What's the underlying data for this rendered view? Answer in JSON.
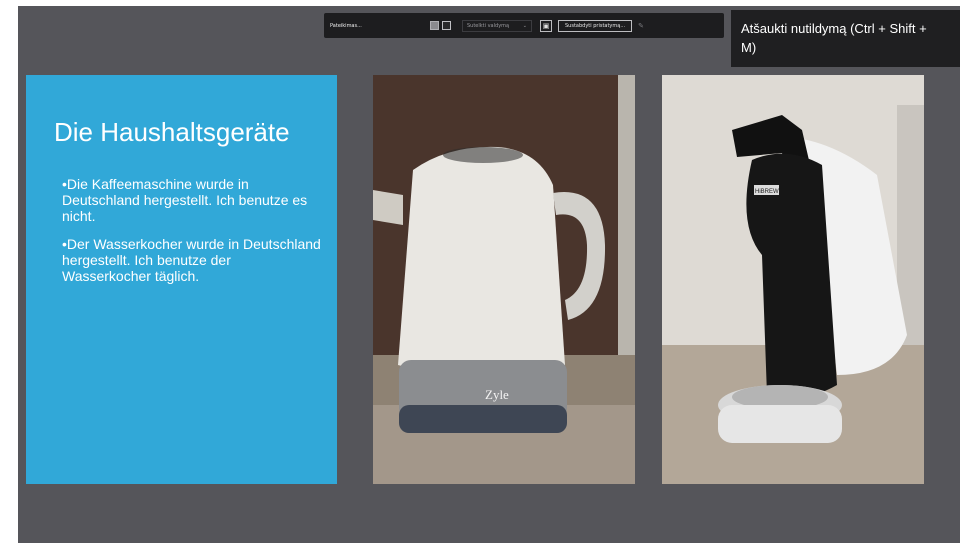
{
  "toolbar": {
    "presenter_name": "Pateikimas...",
    "select_value": "Sutelkti valdymą",
    "button_label": "Sustabdyti pristatymą..."
  },
  "tooltip": {
    "text": "Atšaukti nutildymą (Ctrl + Shift +\nM)"
  },
  "slide": {
    "title": "Die Haushaltsgeräte",
    "bullets": [
      "•Die Kaffeemaschine wurde in Deutschland hergestellt. Ich benutze es nicht.",
      "•Der Wasserkocher wurde in Deutschland hergestellt. Ich benutze der Wasserkocher täglich."
    ],
    "panel_color": "#31a8d8"
  },
  "photos": {
    "kettle_brand": "Zyle",
    "coffee_brand": "HiBREW"
  }
}
